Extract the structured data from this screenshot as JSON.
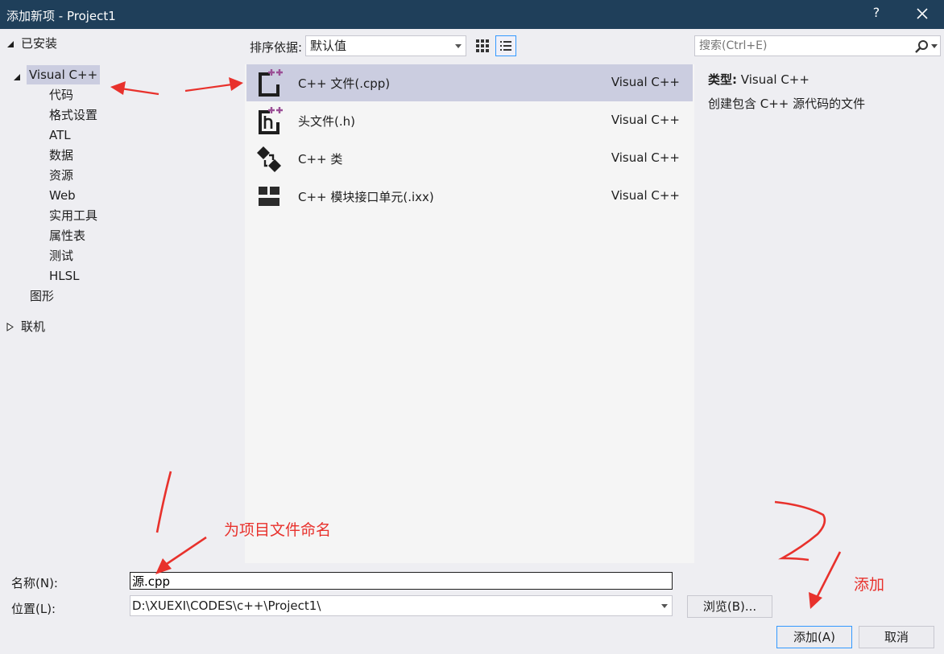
{
  "window": {
    "title": "添加新项 - Project1",
    "help_label": "?"
  },
  "tree": {
    "installed_label": "已安装",
    "visual_cpp_label": "Visual C++",
    "children": [
      "代码",
      "格式设置",
      "ATL",
      "数据",
      "资源",
      "Web",
      "实用工具",
      "属性表",
      "测试",
      "HLSL"
    ],
    "graphics_label": "图形",
    "online_label": "联机"
  },
  "sort": {
    "label": "排序依据:",
    "value": "默认值"
  },
  "templates": [
    {
      "name": "C++ 文件(.cpp)",
      "lang": "Visual C++",
      "icon": "cpp-file-icon"
    },
    {
      "name": "头文件(.h)",
      "lang": "Visual C++",
      "icon": "header-file-icon"
    },
    {
      "name": "C++ 类",
      "lang": "Visual C++",
      "icon": "cpp-class-icon"
    },
    {
      "name": "C++ 模块接口单元(.ixx)",
      "lang": "Visual C++",
      "icon": "module-interface-icon"
    }
  ],
  "search": {
    "placeholder": "搜索(Ctrl+E)"
  },
  "details": {
    "type_label": "类型:",
    "type_value": "Visual C++",
    "description": "创建包含 C++ 源代码的文件"
  },
  "form": {
    "name_label": "名称(N):",
    "name_value": "源.cpp",
    "location_label": "位置(L):",
    "location_value": "D:\\XUEXI\\CODES\\c++\\Project1\\",
    "browse_label": "浏览(B)...",
    "add_label": "添加(A)",
    "cancel_label": "取消"
  },
  "annotations": {
    "step1": "1",
    "name_note": "为项目文件命名",
    "step2": "2",
    "add_note": "添加",
    "color": "#e8312c"
  },
  "colors": {
    "titlebar": "#1f3f5a",
    "selection": "#cbcde0",
    "accent": "#3399ff",
    "icon_purple": "#9b4f96"
  }
}
